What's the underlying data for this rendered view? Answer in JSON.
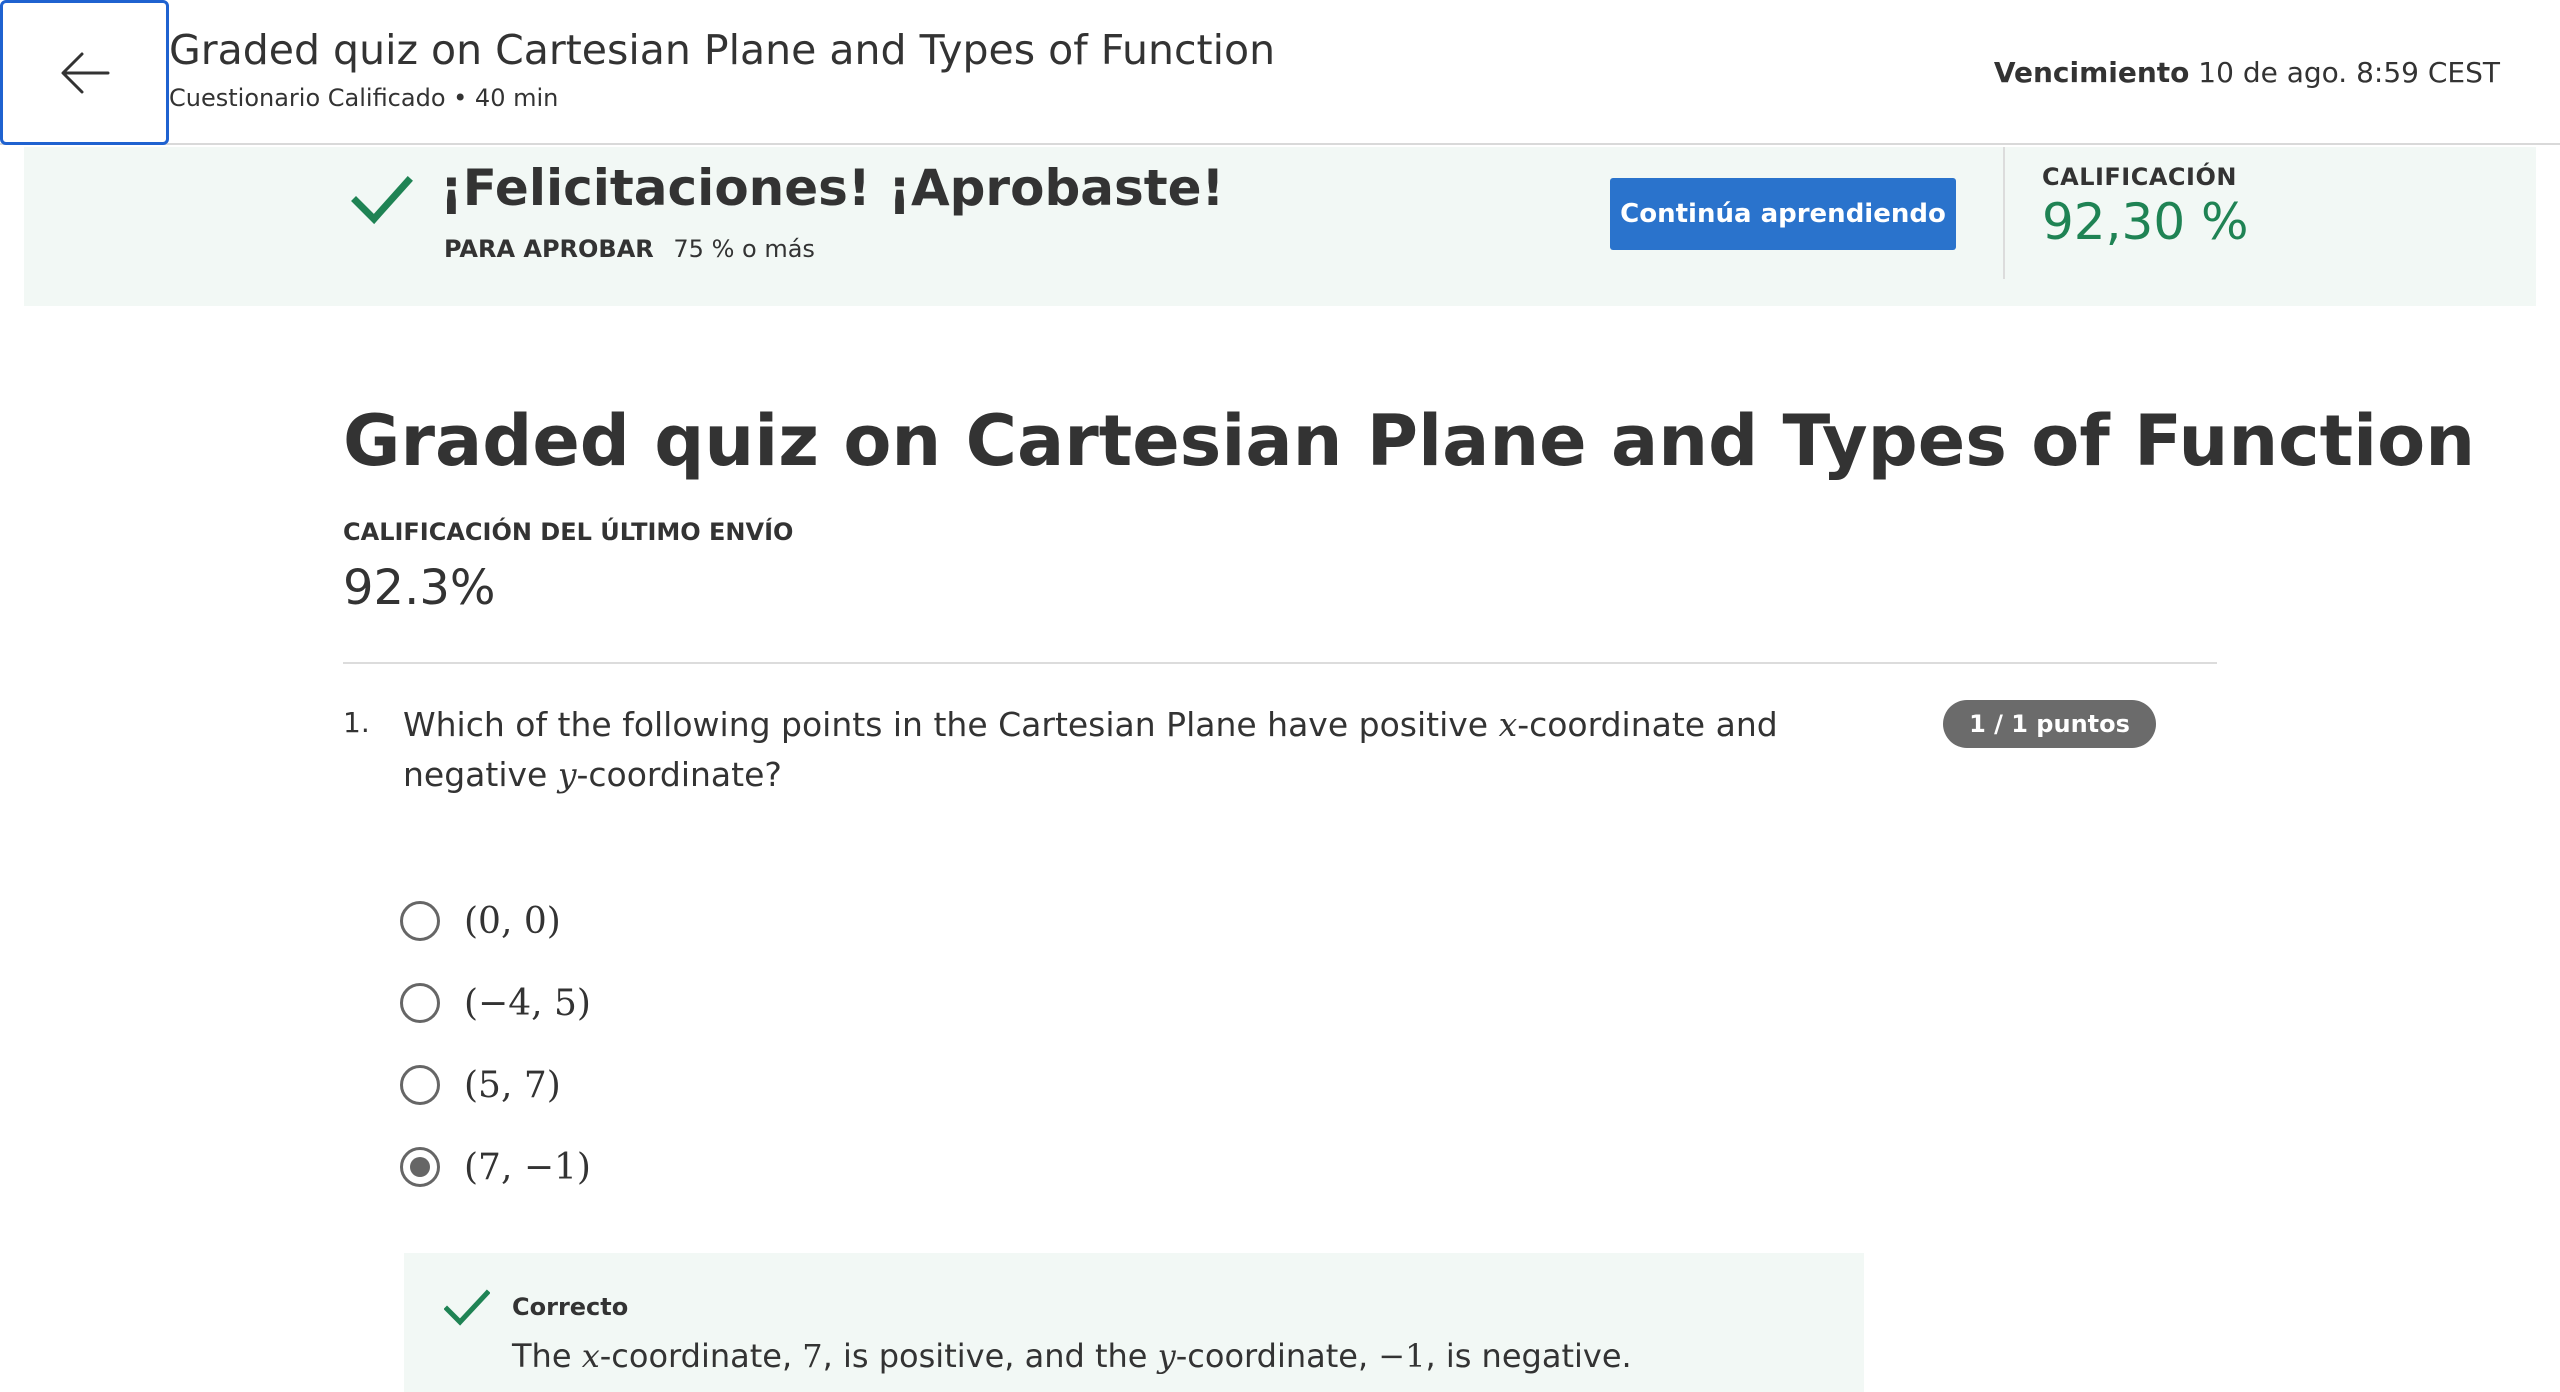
{
  "header": {
    "title": "Graded quiz on Cartesian Plane and Types of Function",
    "subtitle": "Cuestionario Calificado • 40 min",
    "due_label": "Vencimiento",
    "due_value": "10 de ago. 8:59 CEST",
    "back_icon": "arrow-left-icon"
  },
  "banner": {
    "title": "¡Felicitaciones! ¡Aprobaste!",
    "pass_label": "PARA APROBAR",
    "pass_value": "75 % o más",
    "continue_label": "Continúa aprendiendo",
    "grade_label": "CALIFICACIÓN",
    "grade_value": "92,30 %",
    "accent_color": "#1f8354",
    "button_color": "#2a73cc"
  },
  "main": {
    "title": "Graded quiz on Cartesian Plane and Types of Function",
    "last_grade_label": "CALIFICACIÓN DEL ÚLTIMO ENVÍO",
    "last_grade_value": "92.3%"
  },
  "question": {
    "number": "1.",
    "text_part1": "Which of the following points in the Cartesian Plane have positive ",
    "var_x": "x",
    "text_part2": "-coordinate and negative ",
    "var_y": "y",
    "text_part3": "-coordinate?",
    "points": "1 / 1 puntos",
    "options": [
      {
        "label": "(0, 0)",
        "selected": false
      },
      {
        "label": "(−4, 5)",
        "selected": false
      },
      {
        "label": "(5, 7)",
        "selected": false
      },
      {
        "label": "(7, −1)",
        "selected": true
      }
    ]
  },
  "feedback": {
    "title": "Correcto",
    "p1": "The ",
    "x": "x",
    "p2": "-coordinate, ",
    "n1": "7",
    "p3": ", is positive, and the ",
    "y": "y",
    "p4": "-coordinate, ",
    "n2": "−1",
    "p5": ", is negative."
  }
}
